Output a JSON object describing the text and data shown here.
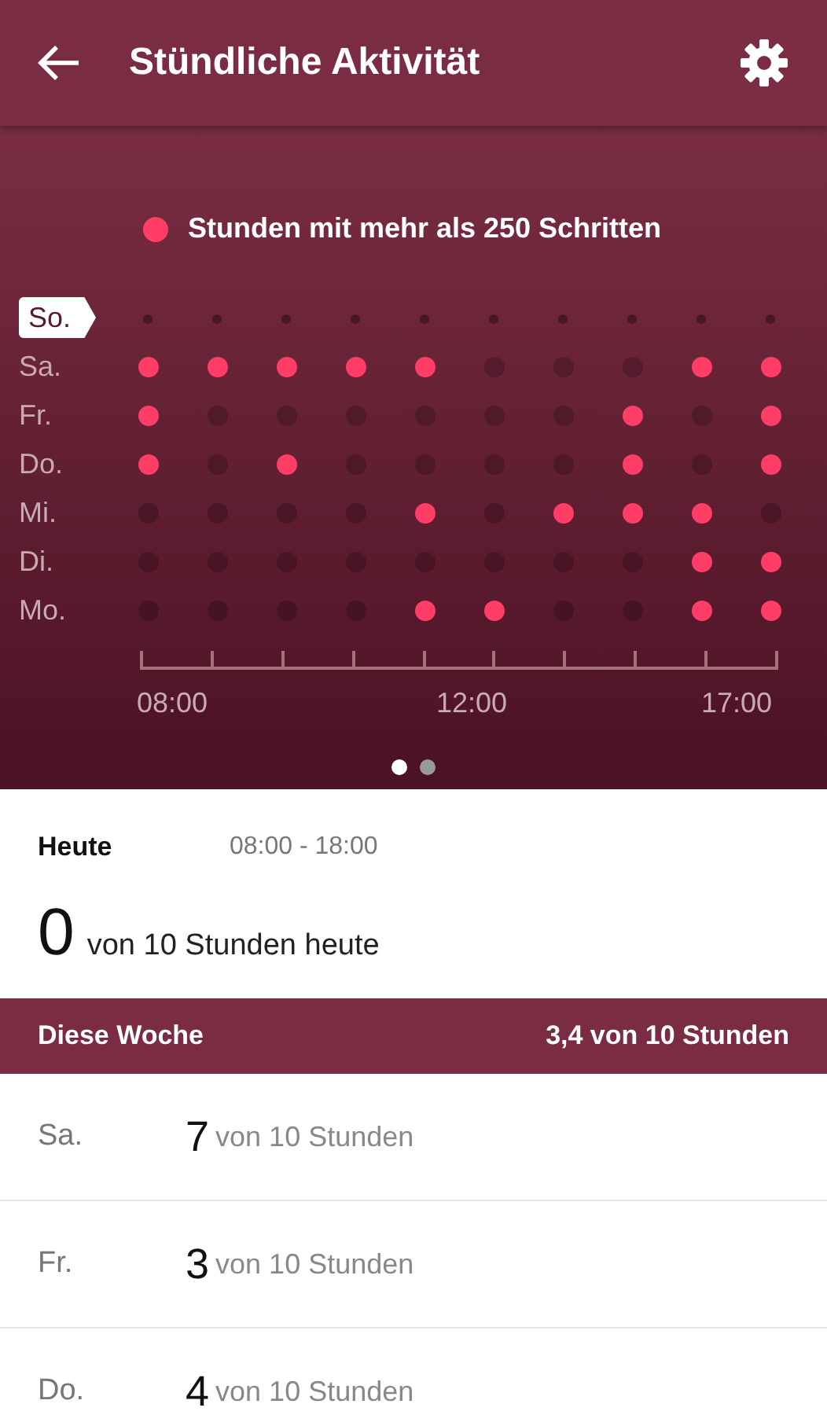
{
  "header": {
    "title": "Stündliche Aktivität"
  },
  "legend": {
    "label": "Stunden mit mehr als 250 Schritten"
  },
  "activity_grid": {
    "rows": [
      {
        "day": "So.",
        "selected": true,
        "hours": [
          false,
          false,
          false,
          false,
          false,
          false,
          false,
          false,
          false,
          false
        ]
      },
      {
        "day": "Sa.",
        "selected": false,
        "hours": [
          true,
          true,
          true,
          true,
          true,
          false,
          false,
          false,
          true,
          true
        ]
      },
      {
        "day": "Fr.",
        "selected": false,
        "hours": [
          true,
          false,
          false,
          false,
          false,
          false,
          false,
          true,
          false,
          true
        ]
      },
      {
        "day": "Do.",
        "selected": false,
        "hours": [
          true,
          false,
          true,
          false,
          false,
          false,
          false,
          true,
          false,
          true
        ]
      },
      {
        "day": "Mi.",
        "selected": false,
        "hours": [
          false,
          false,
          false,
          false,
          true,
          false,
          true,
          true,
          true,
          false
        ]
      },
      {
        "day": "Di.",
        "selected": false,
        "hours": [
          false,
          false,
          false,
          false,
          false,
          false,
          false,
          false,
          true,
          true
        ]
      },
      {
        "day": "Mo.",
        "selected": false,
        "hours": [
          false,
          false,
          false,
          false,
          true,
          true,
          false,
          false,
          true,
          true
        ]
      }
    ],
    "x_labels": [
      "08:00",
      "12:00",
      "17:00"
    ]
  },
  "pager": [
    {
      "selected": true
    },
    {
      "selected": false
    }
  ],
  "today": {
    "label": "Heute",
    "range": "08:00 - 18:00",
    "value": "0",
    "suffix": "von 10 Stunden heute"
  },
  "week": {
    "label": "Diese Woche",
    "summary": "3,4 von 10 Stunden"
  },
  "days": [
    {
      "day": "Sa.",
      "value": "7",
      "suffix": "von 10 Stunden"
    },
    {
      "day": "Fr.",
      "value": "3",
      "suffix": "von 10 Stunden"
    },
    {
      "day": "Do.",
      "value": "4",
      "suffix": "von 10 Stunden"
    }
  ]
}
